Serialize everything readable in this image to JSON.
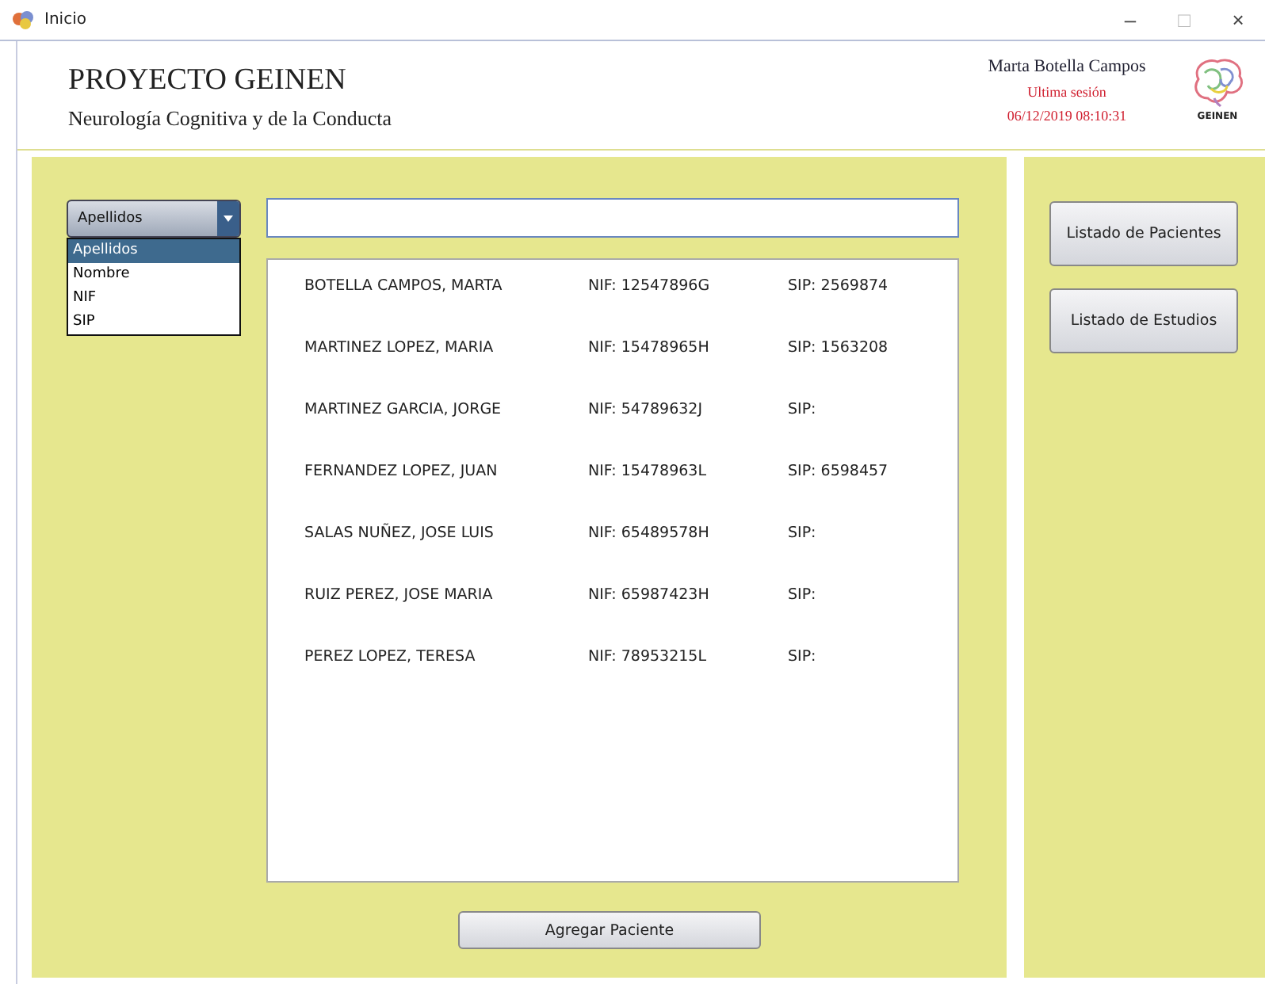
{
  "window": {
    "title": "Inicio",
    "controls": [
      "–",
      "□",
      "×"
    ]
  },
  "header": {
    "title": "PROYECTO GEINEN",
    "subtitle": "Neurología Cognitiva y de la Conducta",
    "user": "Marta Botella Campos",
    "session_label": "Ultima sesión",
    "session_time": "06/12/2019  08:10:31",
    "logo_text": "GEINEN"
  },
  "filter": {
    "value": "Apellidos",
    "expanded": true,
    "options": [
      {
        "label": "Apellidos",
        "selected": true
      },
      {
        "label": "Nombre",
        "selected": false
      },
      {
        "label": "NIF",
        "selected": false
      },
      {
        "label": "SIP",
        "selected": false
      }
    ]
  },
  "patients": [
    {
      "name": "BOTELLA CAMPOS, MARTA",
      "nif": "NIF: 12547896G",
      "sip": "SIP: 2569874"
    },
    {
      "name": "MARTINEZ LOPEZ, MARIA",
      "nif": "NIF: 15478965H",
      "sip": "SIP: 1563208"
    },
    {
      "name": "MARTINEZ GARCIA, JORGE",
      "nif": "NIF: 54789632J",
      "sip": "SIP:"
    },
    {
      "name": "FERNANDEZ LOPEZ, JUAN",
      "nif": "NIF: 15478963L",
      "sip": "SIP: 6598457"
    },
    {
      "name": "SALAS NUÑEZ, JOSE LUIS",
      "nif": "NIF: 65489578H",
      "sip": "SIP:"
    },
    {
      "name": "RUIZ PEREZ, JOSE MARIA",
      "nif": "NIF: 65987423H",
      "sip": "SIP:"
    },
    {
      "name": "PEREZ LOPEZ, TERESA",
      "nif": "NIF: 78953215L",
      "sip": "SIP:"
    }
  ],
  "add_button": "Agregar Paciente",
  "side_buttons": [
    "Listado de Pacientes",
    "Listado de Estudios"
  ]
}
